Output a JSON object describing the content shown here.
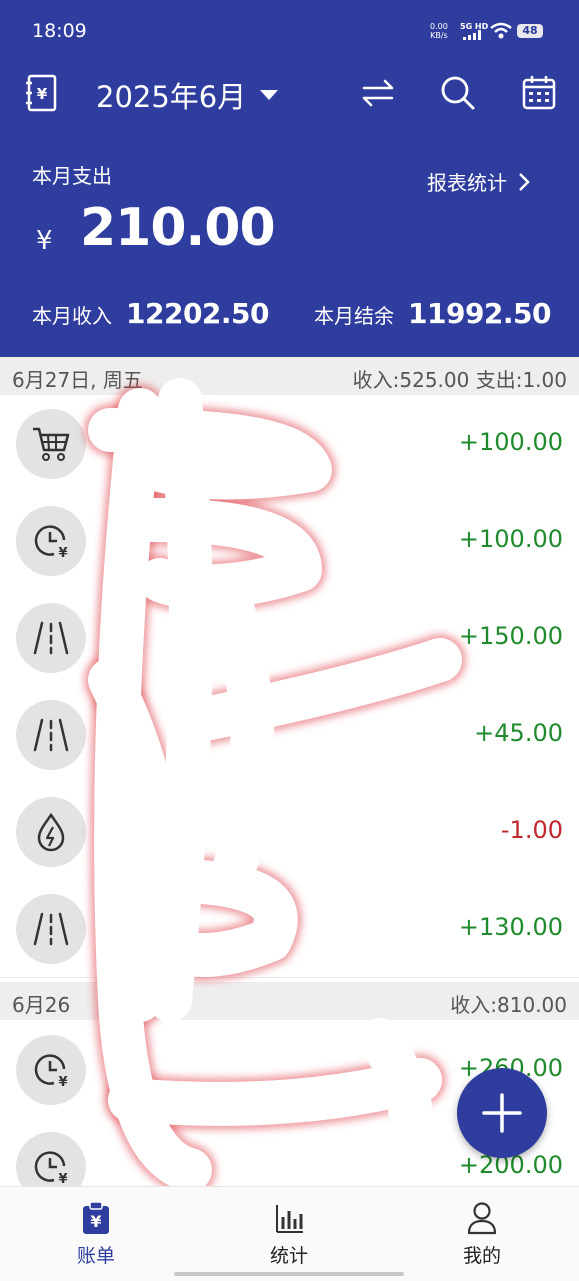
{
  "status": {
    "time": "18:09",
    "net_speed": "0.00",
    "net_unit": "KB/s",
    "signal": "5G HD",
    "battery": "48"
  },
  "toolbar": {
    "month": "2025年6月"
  },
  "summary": {
    "expense_label": "本月支出",
    "expense_currency": "¥",
    "expense_value": "210.00",
    "report_label": "报表统计",
    "income_label": "本月收入",
    "income_value": "12202.50",
    "balance_label": "本月结余",
    "balance_value": "11992.50"
  },
  "days": [
    {
      "date": "6月27日, 周五",
      "summary": "收入:525.00   支出:1.00",
      "items": [
        {
          "icon": "cart-icon",
          "amount": "+100.00",
          "type": "income"
        },
        {
          "icon": "clock-yen-icon",
          "amount": "+100.00",
          "type": "income"
        },
        {
          "icon": "road-icon",
          "amount": "+150.00",
          "type": "income"
        },
        {
          "icon": "road-icon",
          "amount": "+45.00",
          "type": "income"
        },
        {
          "icon": "water-power-icon",
          "amount": "-1.00",
          "type": "expense"
        },
        {
          "icon": "road-icon",
          "amount": "+130.00",
          "type": "income"
        }
      ]
    },
    {
      "date": "6月26",
      "summary": "收入:810.00",
      "items": [
        {
          "icon": "clock-yen-icon",
          "amount": "+260.00",
          "type": "income"
        },
        {
          "icon": "clock-yen-icon",
          "amount": "+200.00",
          "type": "income"
        }
      ]
    }
  ],
  "nav": [
    {
      "label": "账单",
      "icon": "bill-icon",
      "active": true
    },
    {
      "label": "统计",
      "icon": "stats-icon",
      "active": false
    },
    {
      "label": "我的",
      "icon": "profile-icon",
      "active": false
    }
  ],
  "colors": {
    "primary": "#2f3e9e",
    "income": "#1f8b2c",
    "expense": "#c0282d"
  }
}
